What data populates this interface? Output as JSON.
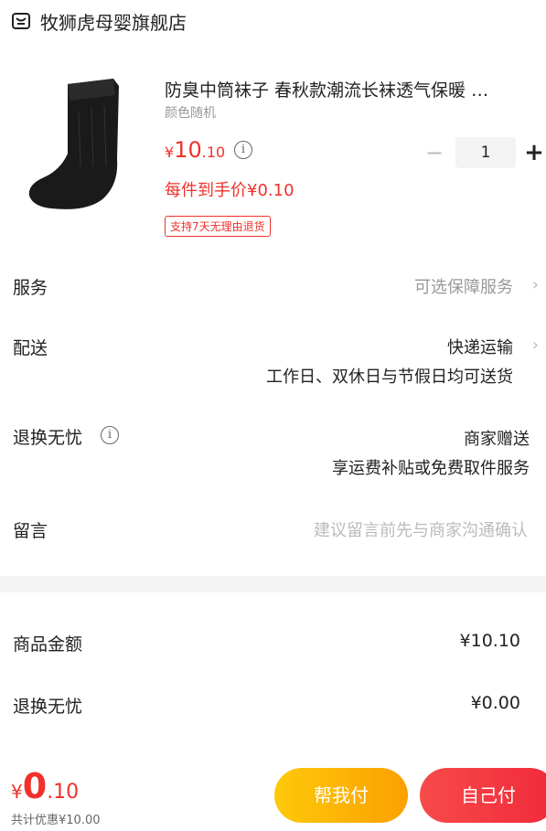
{
  "store": {
    "name": "牧狮虎母婴旗舰店",
    "icon": "store-icon"
  },
  "product": {
    "title": "防臭中筒袜子 春秋款潮流长袜透气保暖 …",
    "sku": "颜色随机",
    "price": {
      "currency": "¥",
      "integer": "10",
      "decimal": ".10"
    },
    "info_icon": "i",
    "quantity": "1",
    "minus": "−",
    "plus": "+",
    "final_price": "每件到手价¥0.10",
    "tag": "支持7天无理由退货"
  },
  "rows": {
    "service": {
      "label": "服务",
      "value": "可选保障服务"
    },
    "delivery": {
      "label": "配送",
      "value": "快递运输",
      "sub": "工作日、双休日与节假日均可送货"
    },
    "returns": {
      "label": "退换无忧",
      "value": "商家赠送",
      "sub": "享运费补贴或免费取件服务"
    },
    "message": {
      "label": "留言",
      "placeholder": "建议留言前先与商家沟通确认"
    }
  },
  "summary": {
    "goods_label": "商品金额",
    "goods_value": "¥10.10",
    "returns_label": "退换无忧",
    "returns_value": "¥0.00"
  },
  "footer": {
    "price": {
      "currency": "¥",
      "integer": "0",
      "decimal": ".10"
    },
    "discount": "共计优惠¥10.00",
    "help_pay": "帮我付",
    "self_pay": "自己付"
  },
  "colors": {
    "accent": "#f0312b",
    "help_button": "#fcb206",
    "self_button": "#f23340"
  }
}
